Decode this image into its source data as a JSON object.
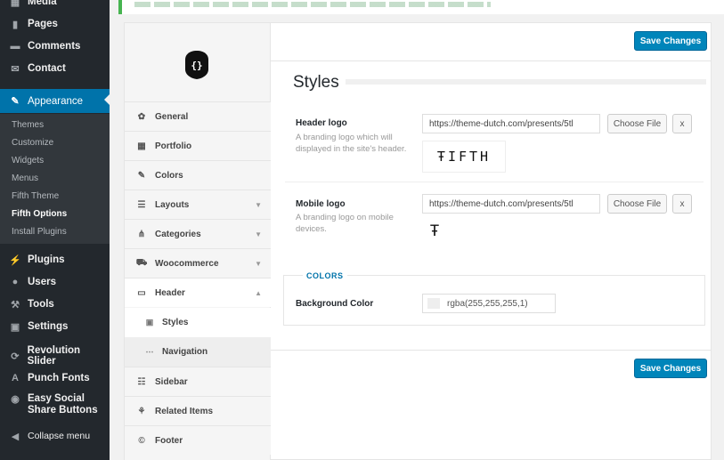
{
  "admin_menu": {
    "items": [
      {
        "label": "Media",
        "icon": "media-icon"
      },
      {
        "label": "Pages",
        "icon": "pages-icon"
      },
      {
        "label": "Comments",
        "icon": "comments-icon"
      },
      {
        "label": "Contact",
        "icon": "mail-icon"
      },
      {
        "label": "Appearance",
        "icon": "brush-icon"
      },
      {
        "label": "Plugins",
        "icon": "plugin-icon"
      },
      {
        "label": "Users",
        "icon": "users-icon"
      },
      {
        "label": "Tools",
        "icon": "wrench-icon"
      },
      {
        "label": "Settings",
        "icon": "settings-icon"
      },
      {
        "label": "Revolution Slider",
        "icon": "refresh-icon"
      },
      {
        "label": "Punch Fonts",
        "icon": "font-icon"
      },
      {
        "label": "Easy Social Share Buttons",
        "icon": "share-icon"
      },
      {
        "label": "Collapse menu",
        "icon": "collapse-icon"
      }
    ],
    "submenu": [
      "Themes",
      "Customize",
      "Widgets",
      "Menus",
      "Fifth Theme",
      "Fifth Options",
      "Install Plugins"
    ]
  },
  "options_nav": {
    "items": [
      {
        "label": "General",
        "icon": "palette-icon"
      },
      {
        "label": "Portfolio",
        "icon": "grid-icon"
      },
      {
        "label": "Colors",
        "icon": "brush-icon"
      },
      {
        "label": "Layouts",
        "icon": "align-icon"
      },
      {
        "label": "Categories",
        "icon": "sitemap-icon"
      },
      {
        "label": "Woocommerce",
        "icon": "cart-icon"
      },
      {
        "label": "Header",
        "icon": "window-icon"
      },
      {
        "label": "Styles",
        "icon": "image-icon"
      },
      {
        "label": "Navigation",
        "icon": "ellipsis-icon"
      },
      {
        "label": "Sidebar",
        "icon": "list-icon"
      },
      {
        "label": "Related Items",
        "icon": "related-icon"
      },
      {
        "label": "Footer",
        "icon": "copyright-icon"
      }
    ]
  },
  "content": {
    "save_label": "Save Changes",
    "section_title": "Styles",
    "header_logo": {
      "label": "Header logo",
      "description": "A branding logo which will displayed in the site's header.",
      "url": "https://theme-dutch.com/presents/5tl",
      "choose_label": "Choose File",
      "remove_label": "x",
      "preview_text": "ŦIFTH"
    },
    "mobile_logo": {
      "label": "Mobile logo",
      "description": "A branding logo on mobile devices.",
      "url": "https://theme-dutch.com/presents/5tl",
      "choose_label": "Choose File",
      "remove_label": "x",
      "preview_text": "Ŧ"
    },
    "colors": {
      "title": "COLORS",
      "bg_label": "Background Color",
      "bg_value": "rgba(255,255,255,1)"
    }
  },
  "colors": {
    "admin_bg": "#23282d",
    "admin_current": "#0073aa",
    "button_primary": "#0085ba",
    "notice_border": "#46b450"
  }
}
